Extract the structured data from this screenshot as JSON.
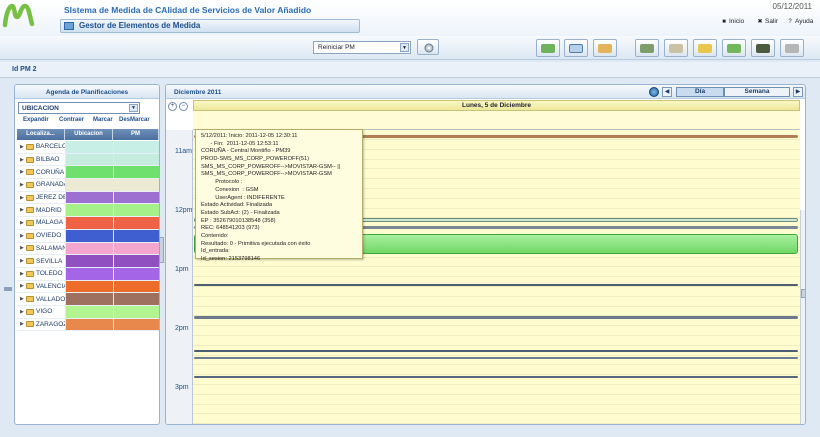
{
  "header": {
    "system_title": "SIstema de Medida de CAlidad de Servicios de Valor Añadido",
    "date": "05/12/2011",
    "module_title": "Gestor de Elementos de Medida",
    "links": [
      {
        "icon": "home-icon",
        "label": "Inicio"
      },
      {
        "icon": "close-icon",
        "label": "Salir"
      },
      {
        "icon": "help-icon",
        "label": "Ayuda"
      }
    ]
  },
  "toolbar": {
    "select_value": "Reiniciar PM",
    "buttons": [
      "toolbar-btn-1",
      "toolbar-btn-2",
      "toolbar-btn-3",
      "toolbar-btn-4",
      "toolbar-btn-5",
      "toolbar-btn-6",
      "toolbar-btn-7",
      "toolbar-btn-8",
      "toolbar-btn-9"
    ]
  },
  "id_bar": {
    "label": "Id PM 2"
  },
  "agenda": {
    "title": "Agenda de Planificaciones",
    "group_select": "UBICACION",
    "actions": [
      "Expandir",
      "Contraer",
      "Marcar",
      "DesMarcar"
    ],
    "columns": [
      "Localiza...",
      "Ubicacion",
      "PM"
    ],
    "rows": [
      {
        "name": "BARCELO",
        "color": "#c8efe6"
      },
      {
        "name": "BILBAO",
        "color": "#c6ecdf"
      },
      {
        "name": "CORUÑA",
        "color": "#6fe06e"
      },
      {
        "name": "GRANADA",
        "color": "#ecead3"
      },
      {
        "name": "JEREZ DE",
        "color": "#9c6fd0"
      },
      {
        "name": "MADRID",
        "color": "#a6f08a"
      },
      {
        "name": "MALAGA",
        "color": "#f06246"
      },
      {
        "name": "OVIEDO",
        "color": "#3f5fd0"
      },
      {
        "name": "SALAMAN",
        "color": "#f4a6cf"
      },
      {
        "name": "SEVILLA",
        "color": "#9050c0"
      },
      {
        "name": "TOLEDO",
        "color": "#a466e6"
      },
      {
        "name": "VALENCIA",
        "color": "#ee6c2a"
      },
      {
        "name": "VALLADO",
        "color": "#9e7060"
      },
      {
        "name": "VIGO",
        "color": "#b2f590"
      },
      {
        "name": "ZARAGOZ",
        "color": "#e8884c"
      }
    ]
  },
  "calendar": {
    "month": "Diciembre 2011",
    "day_title": "Lunes, 5 de Diciembre",
    "views": [
      "Día",
      "Semana"
    ],
    "hours": [
      "11am",
      "12pm",
      "1pm",
      "2pm",
      "3pm"
    ]
  },
  "tooltip": {
    "lines": [
      "5/12/2011: Inicio: 2011-12-05 12:30:11",
      "      - Fin:  2011-12-05 12:53:11",
      "CORUÑA - Central Montiño - PM39",
      "PROD-SMS_MS_CORP_POWEROFF(51)",
      "SMS_MS_CORP_POWEROFF-->MOVISTAR-GSM-- ||",
      "SMS_MS_CORP_POWEROFF-->MOVISTAR-GSM",
      "         Protocolo :",
      "         Conexion  : GSM",
      "         UserAgent : INDIFERENTE",
      "Estado Actividad: Finalizada",
      "Estado SubAct: (2) - Finalizada",
      "EP : 352679010138548 (358)",
      "REC: 648541203 (973)",
      "Contenido:",
      "Resultado: 0 - Primitiva ejecutada con éxito",
      "Id_entrada:",
      "Id_sesion: 2153798146"
    ]
  }
}
